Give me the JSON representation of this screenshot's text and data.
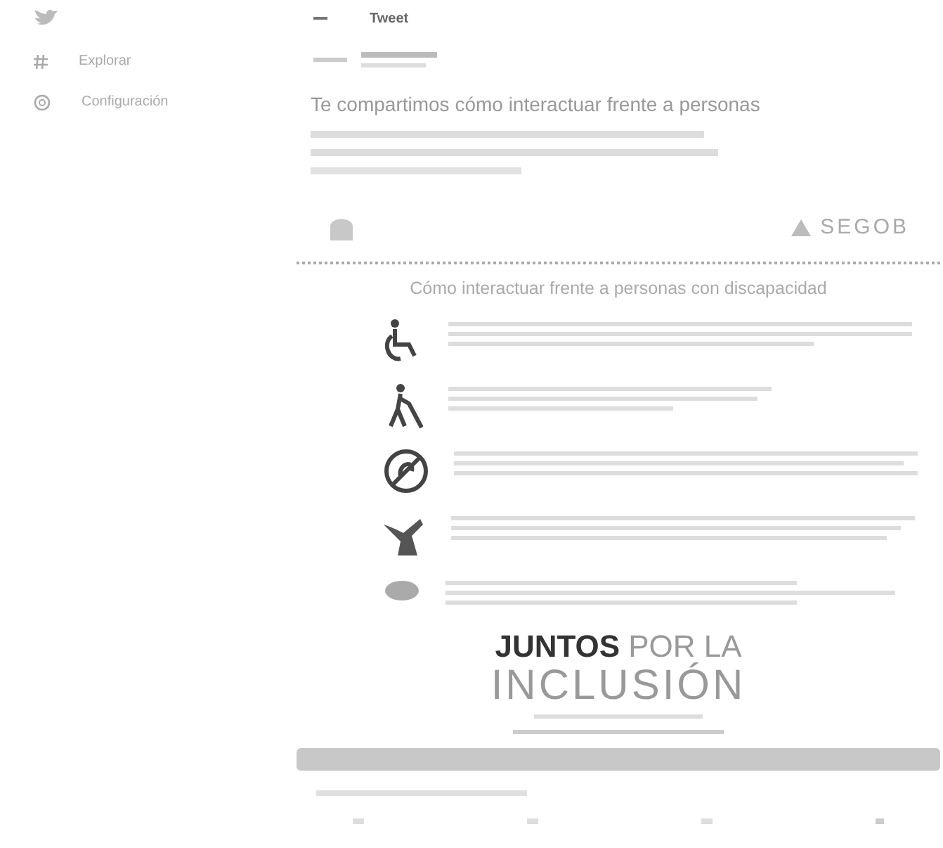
{
  "sidebar": {
    "items": [
      {
        "label": "Explorar"
      },
      {
        "label": "Configuración"
      }
    ]
  },
  "header": {
    "title": "Tweet"
  },
  "tweet": {
    "text_first_line": "Te compartimos cómo interactuar frente a personas",
    "image": {
      "logo_right": "SEGOB",
      "heading": "Cómo interactuar frente a personas con discapacidad",
      "campaign_line_1": "JUNTOS",
      "campaign_line_1b": "POR LA",
      "campaign_line_2": "INCLUSIÓN"
    }
  }
}
